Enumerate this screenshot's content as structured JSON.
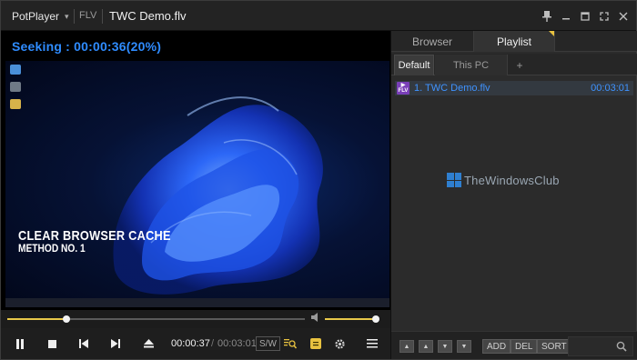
{
  "app": {
    "name": "PotPlayer",
    "format": "FLV",
    "title": "TWC Demo.flv"
  },
  "video": {
    "osd_message": "Seeking : 00:00:36(20%)",
    "caption_line1": "CLEAR BROWSER CACHE",
    "caption_line2": "METHOD NO. 1"
  },
  "playback": {
    "current_time": "00:00:37",
    "separator": "/",
    "duration": "00:03:01",
    "progress_fraction": 0.2,
    "volume_fraction": 1.0,
    "sw_label": "S/W"
  },
  "panel": {
    "tabs": [
      {
        "label": "Browser"
      },
      {
        "label": "Playlist"
      }
    ],
    "subtabs": [
      {
        "label": "Default"
      },
      {
        "label": "This PC"
      },
      {
        "label": "+"
      }
    ],
    "playlist": [
      {
        "name": "1. TWC Demo.flv",
        "duration": "00:03:01",
        "badge": "FLV"
      }
    ],
    "watermark": "TheWindowsClub",
    "buttons": {
      "add": "ADD",
      "del": "DEL",
      "sort": "SORT"
    }
  },
  "colors": {
    "accent_blue": "#2f8cff",
    "progress_yellow": "#e9c94a",
    "flv_badge_purple": "#7a3fb8"
  },
  "icons": {
    "titlebar": [
      "pin-icon",
      "minimize-icon",
      "maximize-icon",
      "fullscreen-icon",
      "close-icon"
    ],
    "controls": [
      "pause-icon",
      "stop-icon",
      "previous-icon",
      "next-icon",
      "eject-icon",
      "search-subtitle-icon",
      "notes-icon",
      "gear-icon",
      "menu-icon"
    ]
  }
}
